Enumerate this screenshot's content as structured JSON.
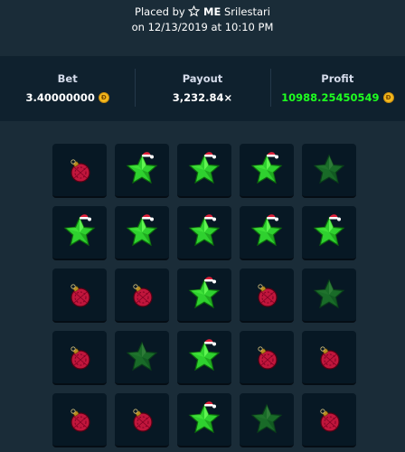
{
  "header": {
    "placed_by": "Placed by",
    "user_badge": "ME",
    "username": "Srilestari",
    "date_line": "on 12/13/2019 at 10:10 PM"
  },
  "stats": {
    "bet_label": "Bet",
    "bet_value": "3.40000000",
    "payout_label": "Payout",
    "payout_value": "3,232.84×",
    "profit_label": "Profit",
    "profit_value": "10988.25450549",
    "coin_icon": "dogecoin-icon",
    "profit_color": "#1fff20"
  },
  "grid": [
    [
      "mine",
      "gem",
      "gem",
      "gem",
      "gem-dim"
    ],
    [
      "gem",
      "gem",
      "gem",
      "gem",
      "gem"
    ],
    [
      "mine",
      "mine",
      "gem",
      "mine",
      "gem-dim"
    ],
    [
      "mine",
      "gem-dim",
      "gem",
      "mine",
      "mine"
    ],
    [
      "mine",
      "mine",
      "gem",
      "gem-dim",
      "mine"
    ]
  ]
}
